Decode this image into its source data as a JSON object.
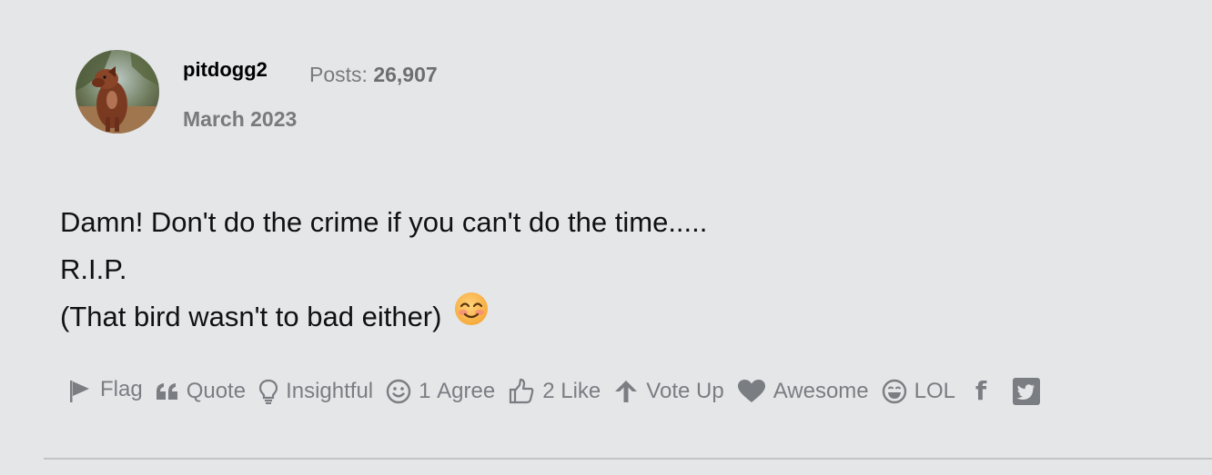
{
  "author": {
    "username": "pitdogg2",
    "posts_label": "Posts:",
    "posts_count": "26,907",
    "date": "March 2023",
    "avatar_icon": "dog-avatar-icon"
  },
  "body": {
    "lines": [
      "Damn! Don't do the crime if you can't do the time.....",
      "R.I.P.",
      "(That bird wasn't to bad either)"
    ],
    "emoji": "smiling-face-emoji"
  },
  "reactions": {
    "flag": "Flag",
    "quote": "Quote",
    "insightful": "Insightful",
    "agree_count": "1",
    "agree": "Agree",
    "like_count": "2",
    "like": "Like",
    "vote_up": "Vote Up",
    "awesome": "Awesome",
    "lol": "LOL",
    "facebook_icon": "f"
  },
  "colors": {
    "background": "#e5e6e8",
    "muted_text": "#7a7a7a",
    "icon_gray": "#7a7d82",
    "divider": "#c3c4c7"
  }
}
